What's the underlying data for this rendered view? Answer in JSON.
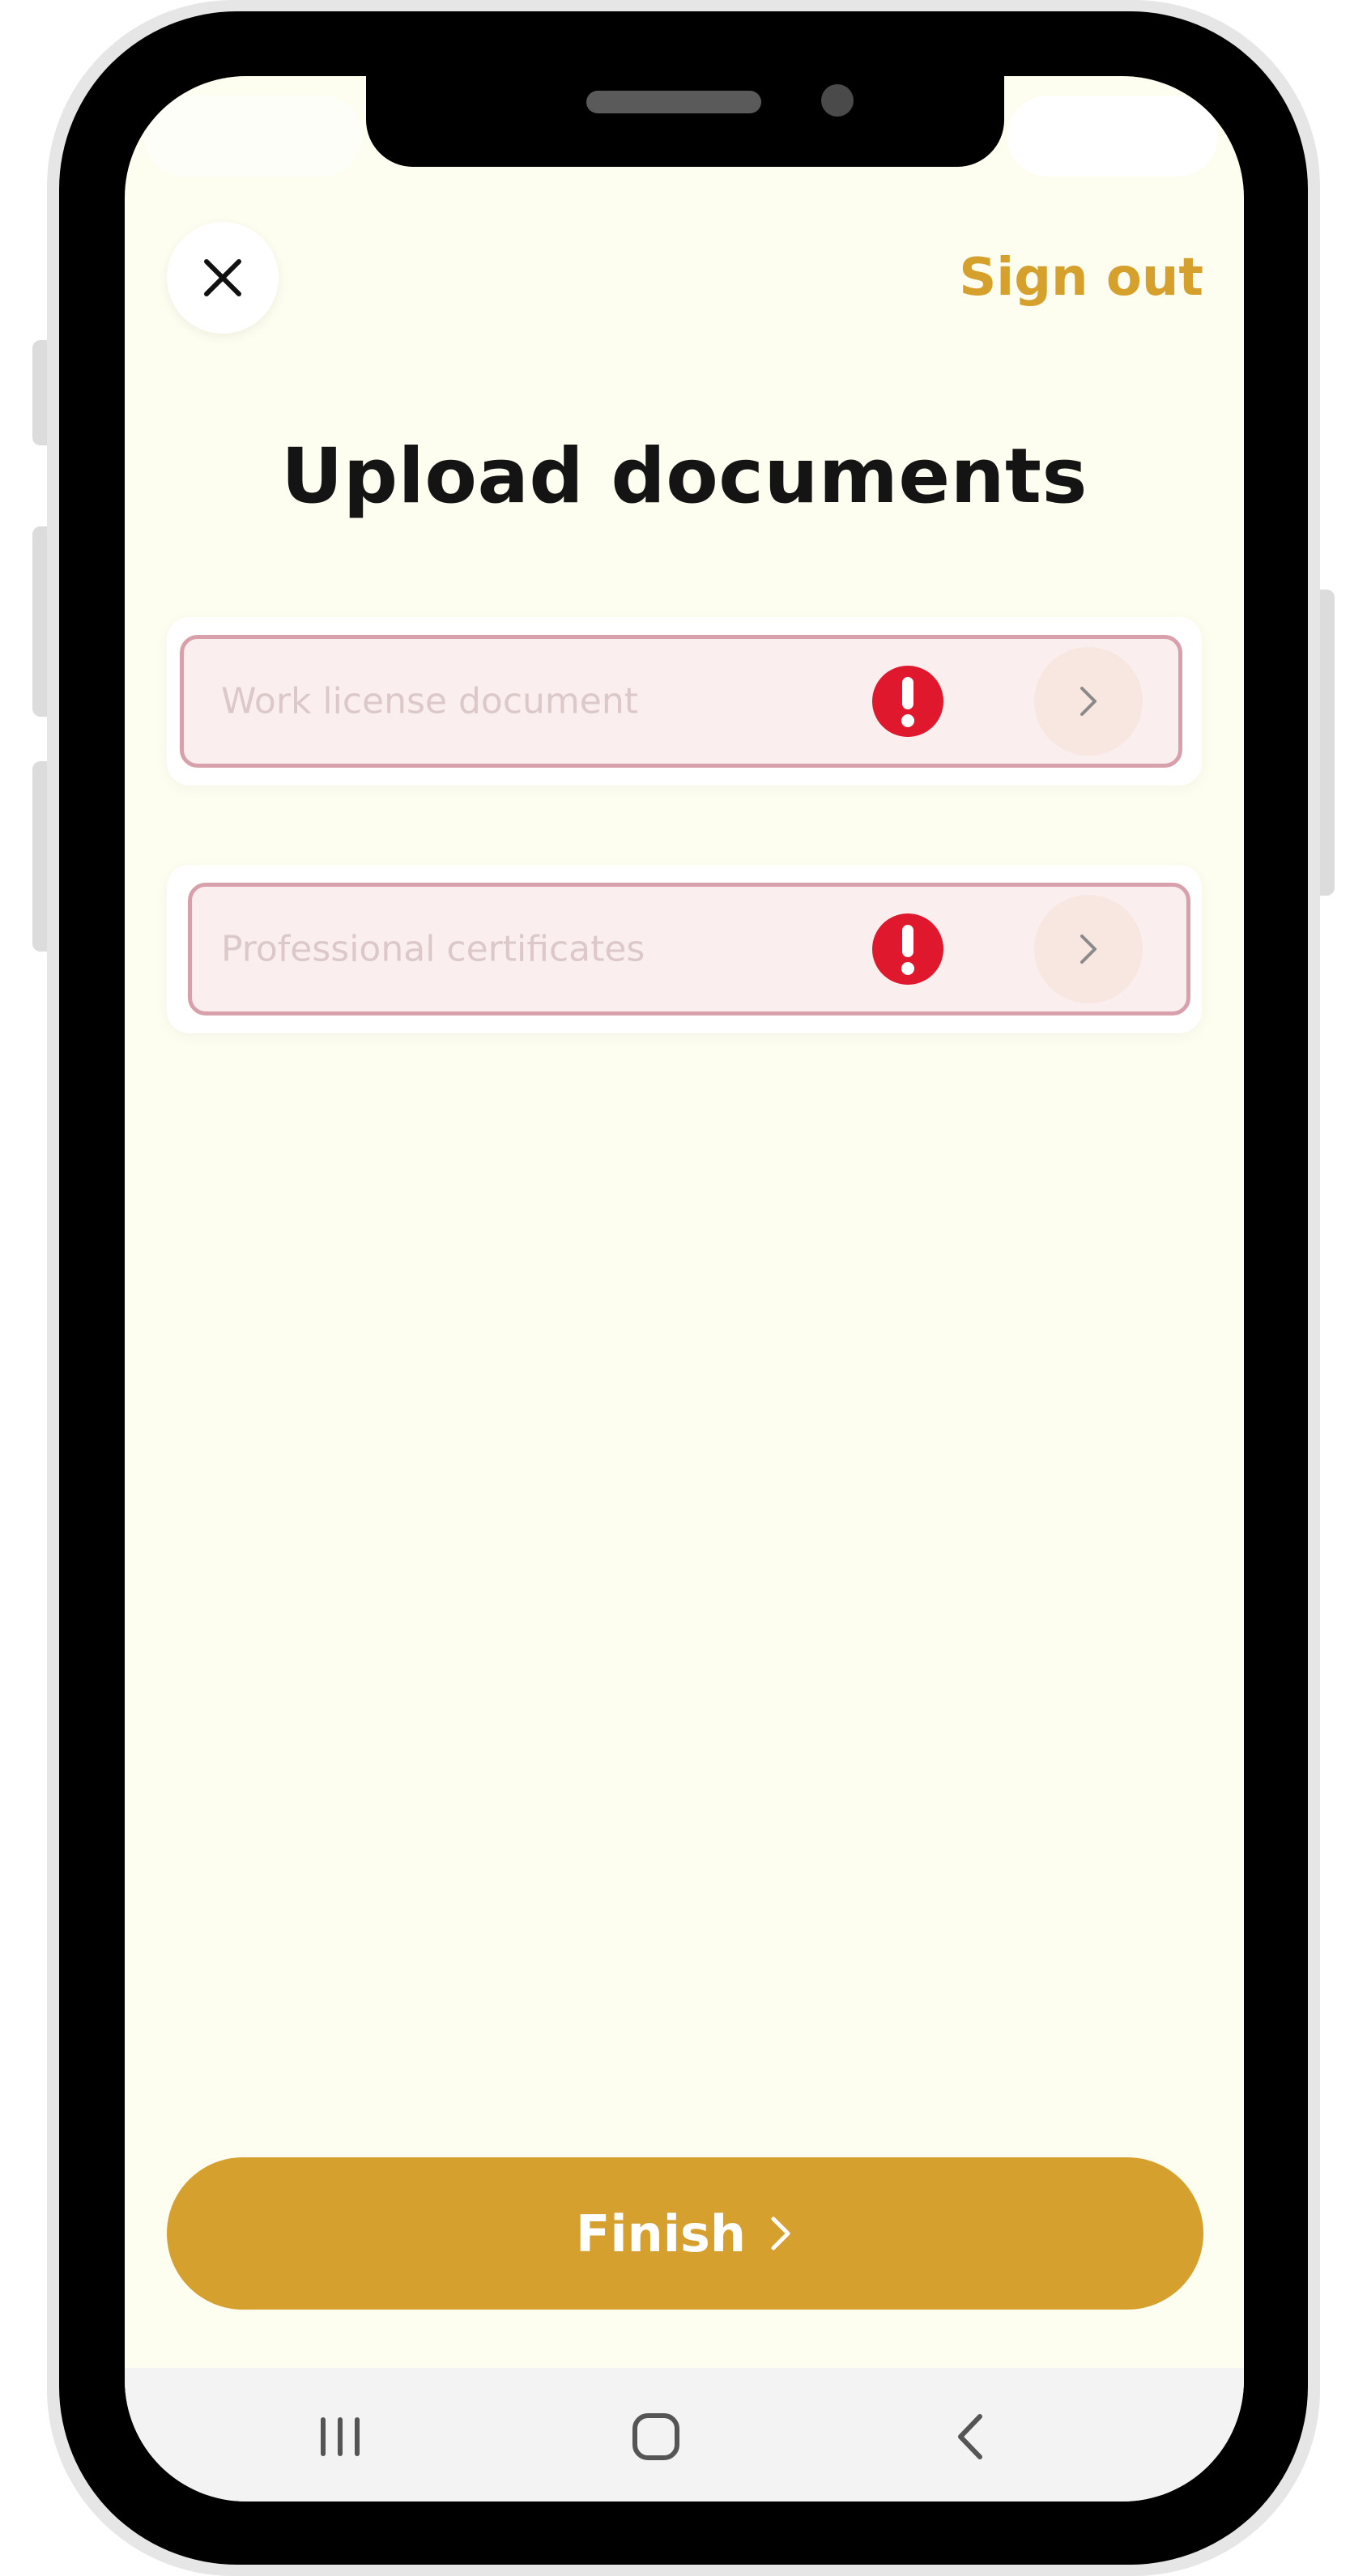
{
  "header": {
    "sign_out_label": "Sign out"
  },
  "page": {
    "title": "Upload documents"
  },
  "documents": [
    {
      "label": "Work license document",
      "status": "missing"
    },
    {
      "label": "Professional certificates",
      "status": "missing"
    }
  ],
  "footer": {
    "finish_label": "Finish"
  },
  "icons": {
    "close": "close-icon",
    "alert": "exclamation-icon",
    "chevron": "chevron-right-icon",
    "recents": "recents-icon",
    "home": "home-icon",
    "back": "back-icon"
  },
  "colors": {
    "accent": "#d6a02e",
    "background": "#fdfdf0",
    "error": "#e0182d",
    "error_border": "#d8a0aa",
    "error_fill": "#fbeeee"
  }
}
